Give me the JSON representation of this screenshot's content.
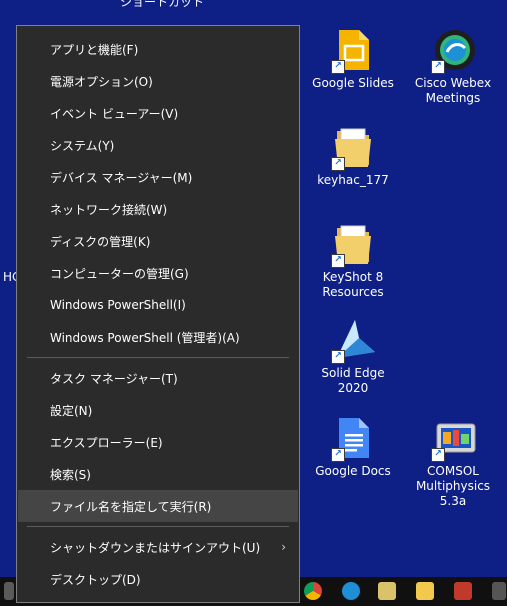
{
  "top_clipped_text": "ショートカット",
  "left_clipped_text": "HC",
  "menu": {
    "items": [
      {
        "label": "アプリと機能(F)"
      },
      {
        "label": "電源オプション(O)"
      },
      {
        "label": "イベント ビューアー(V)"
      },
      {
        "label": "システム(Y)"
      },
      {
        "label": "デバイス マネージャー(M)"
      },
      {
        "label": "ネットワーク接続(W)"
      },
      {
        "label": "ディスクの管理(K)"
      },
      {
        "label": "コンピューターの管理(G)"
      },
      {
        "label": "Windows PowerShell(I)"
      },
      {
        "label": "Windows PowerShell (管理者)(A)"
      },
      {
        "label": "タスク マネージャー(T)"
      },
      {
        "label": "設定(N)"
      },
      {
        "label": "エクスプローラー(E)"
      },
      {
        "label": "検索(S)"
      },
      {
        "label": "ファイル名を指定して実行(R)"
      },
      {
        "label": "シャットダウンまたはサインアウト(U)"
      },
      {
        "label": "デスクトップ(D)"
      }
    ],
    "submenu_arrow": "›"
  },
  "desktop_icons": [
    {
      "label": "Google Slides"
    },
    {
      "label": "Cisco Webex Meetings"
    },
    {
      "label": "keyhac_177"
    },
    {
      "label": "KeyShot 8 Resources"
    },
    {
      "label": "Solid Edge 2020"
    },
    {
      "label": "Google Docs"
    },
    {
      "label": "COMSOL Multiphysics 5.3a"
    }
  ],
  "colors": {
    "desktop_bg": "#0e1f86",
    "menu_bg": "#2b2b2b",
    "menu_hover": "#454545"
  }
}
